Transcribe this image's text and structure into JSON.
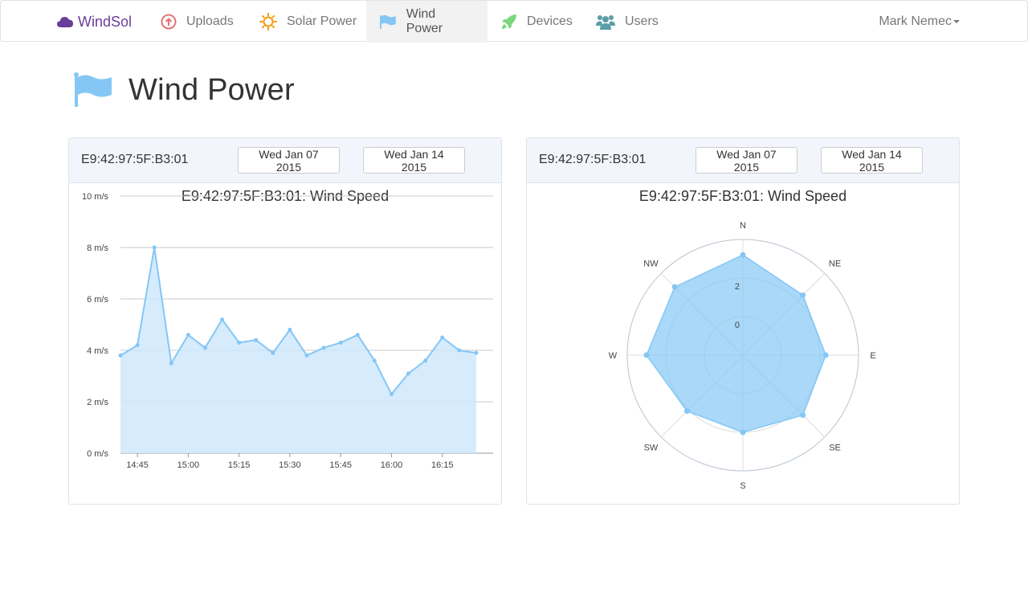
{
  "nav": {
    "brand": "WindSol",
    "items": [
      {
        "label": "Uploads",
        "icon": "upload-icon",
        "active": false
      },
      {
        "label": "Solar Power",
        "icon": "sun-icon",
        "active": false
      },
      {
        "label": "Wind Power",
        "icon": "flag-icon",
        "active": true
      },
      {
        "label": "Devices",
        "icon": "rocket-icon",
        "active": false
      },
      {
        "label": "Users",
        "icon": "users-icon",
        "active": false
      }
    ],
    "user": "Mark Nemec"
  },
  "page": {
    "title": "Wind Power",
    "icon": "flag-icon"
  },
  "colors": {
    "brand": "#6a3d9a",
    "series": "#84c7f5",
    "series_fill": "#cfe8fb",
    "panel_heading": "#f2f6fc"
  },
  "panels": [
    {
      "device": "E9:42:97:5F:B3:01",
      "start_date": "Wed Jan 07 2015",
      "end_date": "Wed Jan 14 2015",
      "chart_title": "E9:42:97:5F:B3:01: Wind Speed"
    },
    {
      "device": "E9:42:97:5F:B3:01",
      "start_date": "Wed Jan 07 2015",
      "end_date": "Wed Jan 14 2015",
      "chart_title": "E9:42:97:5F:B3:01: Wind Speed"
    }
  ],
  "chart_data": [
    {
      "type": "area",
      "title": "E9:42:97:5F:B3:01: Wind Speed",
      "x_range": [
        "14:40",
        "16:30"
      ],
      "x_ticks": [
        "14:45",
        "15:00",
        "15:15",
        "15:30",
        "15:45",
        "16:00",
        "16:15"
      ],
      "y_ticks": [
        "0 m/s",
        "2 m/s",
        "4 m/s",
        "6 m/s",
        "8 m/s",
        "10 m/s"
      ],
      "ylim": [
        0,
        10
      ],
      "grid": true,
      "series": [
        {
          "x": [
            "14:40",
            "14:45",
            "14:50",
            "14:55",
            "15:00",
            "15:05",
            "15:10",
            "15:15",
            "15:20",
            "15:25",
            "15:30",
            "15:35",
            "15:40",
            "15:45",
            "15:50",
            "15:55",
            "16:00",
            "16:05",
            "16:10",
            "16:15",
            "16:20",
            "16:25"
          ],
          "values": [
            3.8,
            4.2,
            8.0,
            3.5,
            4.6,
            4.1,
            5.2,
            4.3,
            4.4,
            3.9,
            4.8,
            3.8,
            4.1,
            4.3,
            4.6,
            3.6,
            2.3,
            3.1,
            3.6,
            4.5,
            4.0,
            3.9
          ]
        }
      ]
    },
    {
      "type": "radar",
      "title": "E9:42:97:5F:B3:01: Wind Speed",
      "categories": [
        "N",
        "NE",
        "E",
        "SE",
        "S",
        "SW",
        "W",
        "NW"
      ],
      "values": [
        3.2,
        2.4,
        2.3,
        2.4,
        2.0,
        2.1,
        3.0,
        3.0
      ],
      "rlim": [
        -2,
        4
      ],
      "r_ticks": [
        0,
        2
      ],
      "grid": true
    }
  ]
}
